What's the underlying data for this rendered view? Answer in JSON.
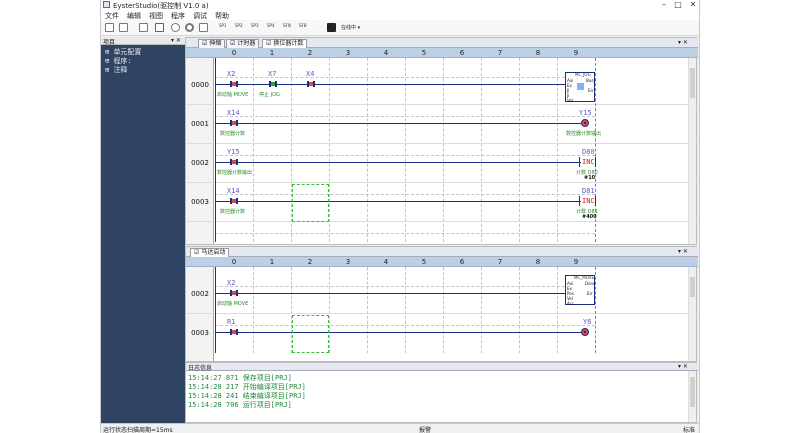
{
  "app": {
    "title": "EysterStudio(驱控制 V1.0 a)"
  },
  "window_controls": {
    "minimize": "–",
    "maximize": "□",
    "close": "✕"
  },
  "menu": [
    "文件",
    "编辑",
    "视图",
    "程序",
    "调试",
    "帮助"
  ],
  "toolbar": {
    "labels": [
      "SP1",
      "SP2",
      "SP3",
      "SP4",
      "SFN",
      "SFB"
    ],
    "mode_label": "在线中 ▾"
  },
  "tree": {
    "title": "项目",
    "pin": "▾ ✕",
    "items": [
      {
        "prefix": "⊞",
        "label": "单元配置"
      },
      {
        "prefix": "⊞",
        "label": "程序:"
      },
      {
        "prefix": "⊞",
        "label": "注释"
      }
    ]
  },
  "editor": {
    "tabs": [
      "伸缩",
      "计时器",
      "换位器计数"
    ],
    "pin": "▾ ✕",
    "columns": [
      "0",
      "1",
      "2",
      "3",
      "4",
      "5",
      "6",
      "7",
      "8",
      "9"
    ],
    "rows": [
      "0000",
      "0001",
      "0002",
      "0003"
    ],
    "rungs": {
      "r0": {
        "c0": "X2",
        "c0_cmt": "启动轴 MOVE",
        "c1": "X7",
        "c1_cmt": "停止 JOG",
        "c2": "X4",
        "fb": "MC_JOG",
        "fb_pins": [
          "Axi",
          "Ex",
          "Jl",
          "Ji",
          "Vel"
        ],
        "fb_out": [
          "Busy",
          "Err"
        ]
      },
      "r1": {
        "c0": "X14",
        "c0_cmt": "数控器计数",
        "out": "Y15",
        "out_cmt": "数控器计数输出"
      },
      "r2": {
        "c0": "Y15",
        "c0_cmt": "数控器计数输出",
        "out": "D80",
        "op": "INC",
        "out_cmt": "计数 D80",
        "out_val": "#10"
      },
      "r3": {
        "c0": "X14",
        "c0_cmt": "数控器计数",
        "out": "D81",
        "op": "INC",
        "out_cmt": "计数 D81",
        "out_val": "#400"
      }
    }
  },
  "editor2": {
    "tab": "马达启动",
    "pin": "▾ ✕",
    "rows": [
      "0002",
      "0003"
    ],
    "rungs": {
      "r0": {
        "c0": "X2",
        "c0_cmt": "启动轴 MOVE",
        "fb": "MC_MOVE",
        "fb_pins": [
          "Axi",
          "Ex",
          "Pos",
          "Vel",
          "Acc"
        ],
        "fb_out": [
          "Done",
          "Err"
        ]
      },
      "r1": {
        "c0": "R1",
        "out": "Y6"
      }
    }
  },
  "log": {
    "title": "日志信息",
    "pin": "▾ ✕",
    "lines": [
      "15:14:27 871  保存项目[PRJ]",
      "15:14:28 217  开始编译项目[PRJ]",
      "15:14:28 241  结束编译项目[PRJ]",
      "15:14:28 706  运行项目[PRJ]"
    ]
  },
  "status": {
    "left": "运行状态",
    "cycle": "扫描周期=15ms",
    "center": "报警",
    "right": "标准"
  }
}
